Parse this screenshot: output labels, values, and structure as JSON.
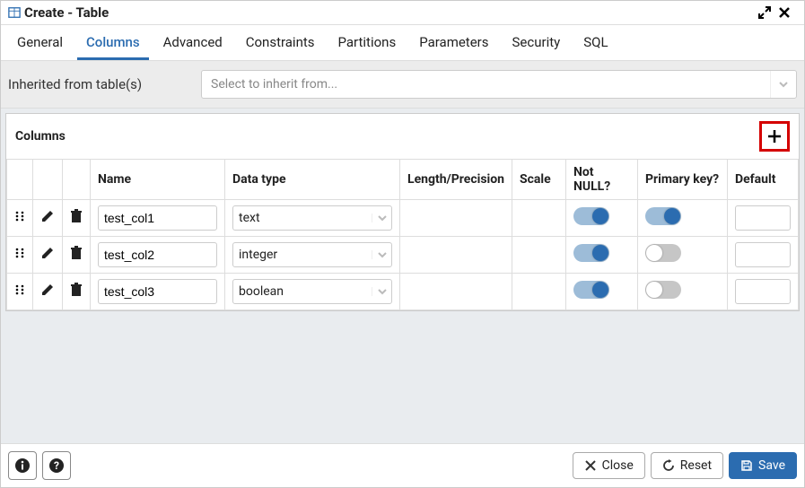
{
  "title": "Create - Table",
  "tabs": [
    "General",
    "Columns",
    "Advanced",
    "Constraints",
    "Partitions",
    "Parameters",
    "Security",
    "SQL"
  ],
  "active_tab_index": 1,
  "inherit": {
    "label": "Inherited from table(s)",
    "placeholder": "Select to inherit from..."
  },
  "columns_section": {
    "title": "Columns",
    "headers": {
      "name": "Name",
      "data_type": "Data type",
      "length": "Length/Precision",
      "scale": "Scale",
      "not_null": "Not NULL?",
      "primary_key": "Primary key?",
      "default": "Default"
    },
    "rows": [
      {
        "name": "test_col1",
        "data_type": "text",
        "length": "",
        "scale": "",
        "not_null": true,
        "primary_key": true,
        "default": ""
      },
      {
        "name": "test_col2",
        "data_type": "integer",
        "length": "",
        "scale": "",
        "not_null": true,
        "primary_key": false,
        "default": ""
      },
      {
        "name": "test_col3",
        "data_type": "boolean",
        "length": "",
        "scale": "",
        "not_null": true,
        "primary_key": false,
        "default": ""
      }
    ]
  },
  "footer": {
    "close": "Close",
    "reset": "Reset",
    "save": "Save"
  }
}
